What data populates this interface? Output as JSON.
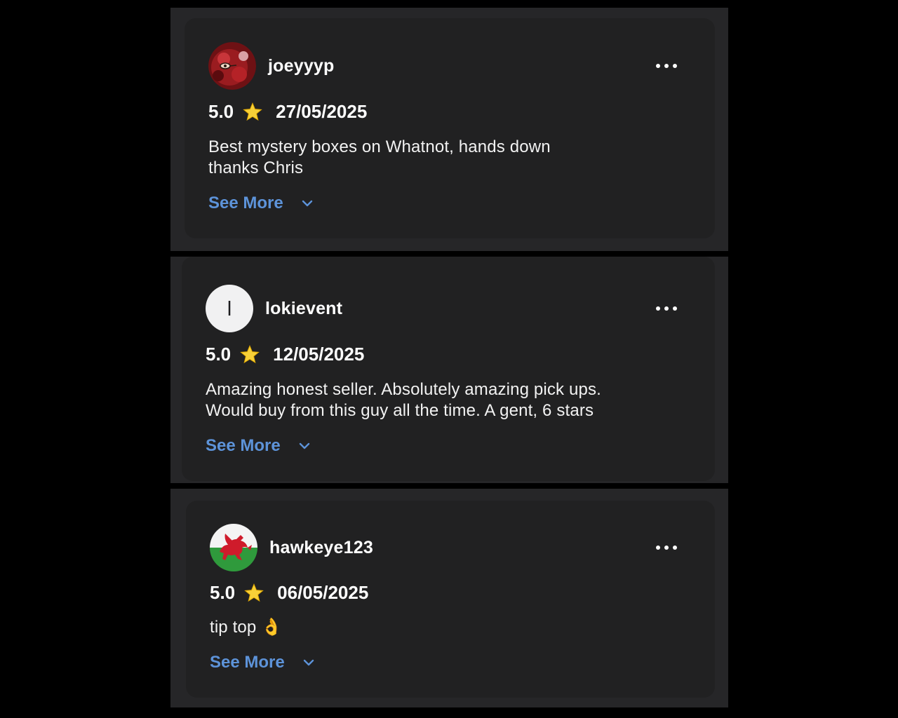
{
  "reviews": [
    {
      "username": "joeyyyp",
      "avatar": "red-painted-face-avatar",
      "rating": "5.0",
      "date": "27/05/2025",
      "text": "Best mystery boxes on Whatnot, hands down\nthanks Chris",
      "see_more": "See More"
    },
    {
      "username": "lokievent",
      "avatar": "letter-avatar",
      "avatar_letter": "l",
      "rating": "5.0",
      "date": "12/05/2025",
      "text": "Amazing honest seller. Absolutely amazing pick ups.\nWould buy from this guy all the time. A gent, 6 stars",
      "see_more": "See More"
    },
    {
      "username": "hawkeye123",
      "avatar": "welsh-flag-avatar",
      "rating": "5.0",
      "date": "06/05/2025",
      "text": "tip top 👌",
      "see_more": "See More"
    }
  ],
  "colors": {
    "background": "#000000",
    "panel": "#262628",
    "card": "#212122",
    "link": "#5d93d9",
    "star": "#f7d038"
  }
}
